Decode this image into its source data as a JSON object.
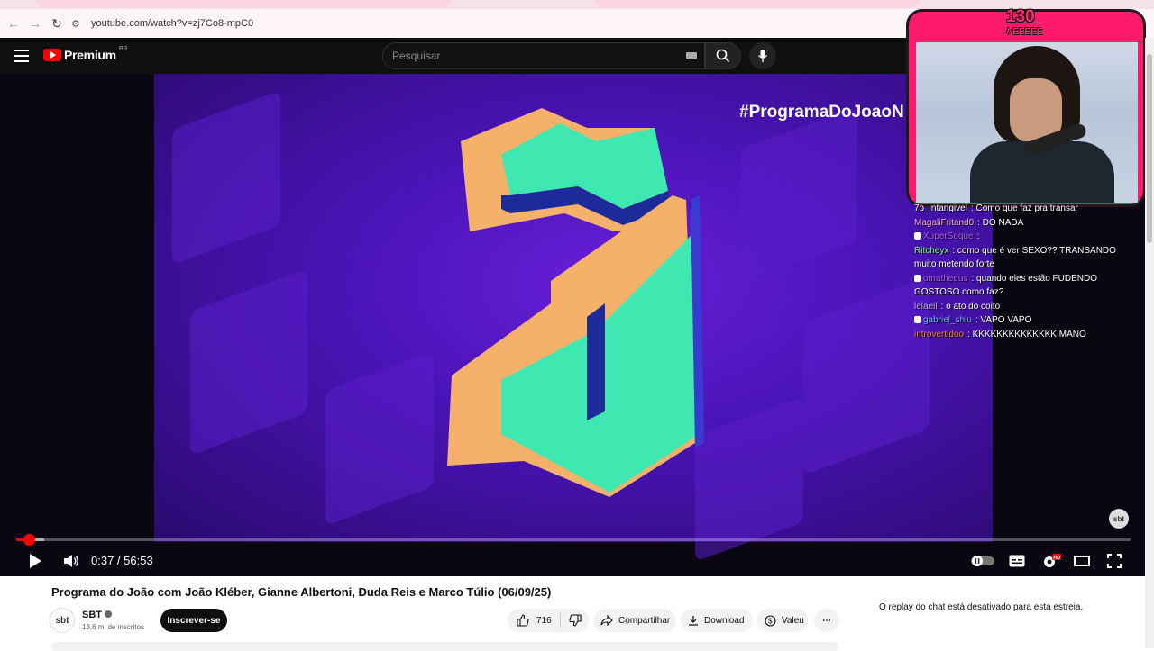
{
  "browser": {
    "url": "youtube.com/watch?v=zj7Co8-mpC0"
  },
  "header": {
    "brand": "Premium",
    "region": "BR",
    "search_placeholder": "Pesquisar"
  },
  "player": {
    "hashtag": "#ProgramaDoJoaoN",
    "watermark": "sbt",
    "time_display": "0:37 / 56:53",
    "progress_fraction": 0.011,
    "buffer_fraction": 0.025
  },
  "overlay": {
    "counter": "130",
    "counter_label": "AEEEEE",
    "chat": [
      {
        "user": "7o_intangivel",
        "user_color": "#ffffff",
        "badge": false,
        "msg": ": Como que faz pra transar"
      },
      {
        "user": "MagaliFritand0",
        "user_color": "#ffa1e8",
        "badge": false,
        "msg": ": DO NADA"
      },
      {
        "user": "XuperSoque",
        "user_color": "#b45cff",
        "badge": true,
        "msg": ":"
      },
      {
        "user": "Ritcheyx",
        "user_color": "#7dff6a",
        "badge": false,
        "msg": ": como que é ver SEXO?? TRANSANDO muito metendo forte"
      },
      {
        "user": "omatheeus",
        "user_color": "#b45cff",
        "badge": true,
        "msg": ": quando eles estão FUDENDO GOSTOSO como faz?"
      },
      {
        "user": "lelaeil",
        "user_color": "#c9a6ff",
        "badge": false,
        "msg": ": o ato do coito"
      },
      {
        "user": "gabriel_shiu",
        "user_color": "#6ab7ff",
        "badge": true,
        "msg": ": VAPO VAPO"
      },
      {
        "user": "introvertidoo",
        "user_color": "#ff7a3d",
        "badge": false,
        "msg": ": KKKKKKKKKKKKKK MANO"
      }
    ]
  },
  "video": {
    "title": "Programa do João com João Kléber, Gianne Albertoni, Duda Reis e Marco Túlio (06/09/25)",
    "channel": "SBT",
    "subscribers": "13,6 mi de inscritos",
    "subscribe_label": "Inscrever-se",
    "likes": "716",
    "share_label": "Compartilhar",
    "download_label": "Download",
    "valeu_label": "Valeu",
    "chat_replay_notice": "O replay do chat está desativado para esta estreia."
  },
  "colors": {
    "yt_red": "#ff0000",
    "overlay_pink": "#ff1b6b",
    "scene_purple": "#4a14b8",
    "shape_green": "#3ee8b0",
    "shape_orange": "#f5b06a"
  }
}
